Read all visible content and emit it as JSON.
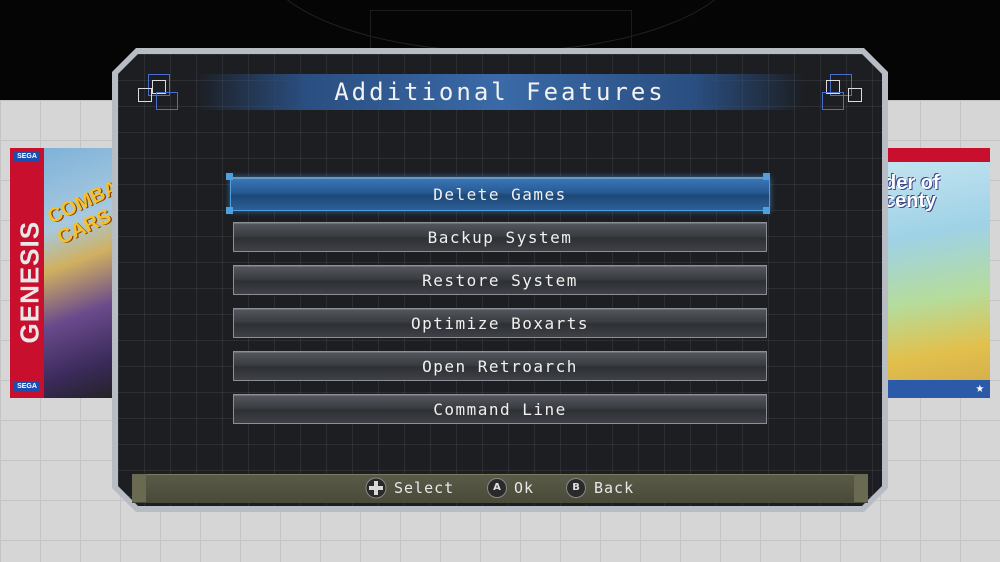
{
  "dialog": {
    "title": "Additional Features"
  },
  "menu": {
    "items": [
      {
        "label": "Delete Games",
        "selected": true
      },
      {
        "label": "Backup System",
        "selected": false
      },
      {
        "label": "Restore System",
        "selected": false
      },
      {
        "label": "Optimize Boxarts",
        "selected": false
      },
      {
        "label": "Open Retroarch",
        "selected": false
      },
      {
        "label": "Command Line",
        "selected": false
      }
    ]
  },
  "footer": {
    "select_icon": "dpad-icon",
    "select_label": "Select",
    "ok_button": "A",
    "ok_label": "Ok",
    "back_button": "B",
    "back_label": "Back"
  },
  "boxart_left": {
    "platform": "GENESIS",
    "brand_top": "SEGA",
    "brand_bottom": "SEGA",
    "title_fragment": "COMBAT CARS"
  },
  "boxart_right": {
    "title_fragment": "der of centy"
  },
  "colors": {
    "accent": "#3a78b8",
    "panel": "#1c1e22",
    "frame": "#b8bcc4"
  }
}
